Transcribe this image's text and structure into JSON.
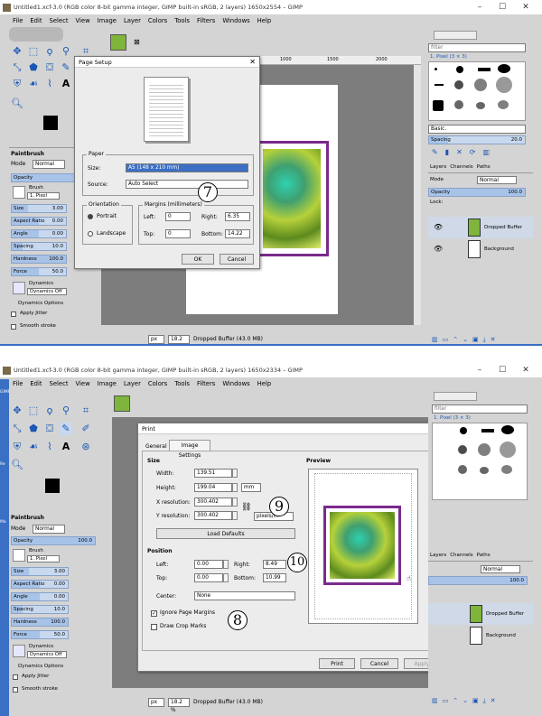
{
  "top": {
    "window_title": "Untitled1.xcf-3.0 (RGB color 8-bit gamma integer, GIMP built-in sRGB, 2 layers) 1650x2554 – GIMP",
    "menu": [
      "File",
      "Edit",
      "Select",
      "View",
      "Image",
      "Layer",
      "Colors",
      "Tools",
      "Filters",
      "Windows",
      "Help"
    ],
    "ruler_marks": [
      "1000",
      "1500",
      "2000"
    ],
    "tool_options": {
      "panel_title": "Paintbrush",
      "mode_label": "Mode",
      "mode_value": "Normal",
      "opacity_label": "Opacity",
      "brush_label": "Brush",
      "brush_value": "1. Pixel",
      "size": {
        "label": "Size",
        "value": "3.00"
      },
      "aspect": {
        "label": "Aspect Ratio",
        "value": "0.00"
      },
      "angle": {
        "label": "Angle",
        "value": "0.00"
      },
      "spacing": {
        "label": "Spacing",
        "value": "10.0"
      },
      "hardness": {
        "label": "Hardness",
        "value": "100.0"
      },
      "force": {
        "label": "Force",
        "value": "50.0"
      },
      "dynamics_label": "Dynamics",
      "dynamics_value": "Dynamics Off",
      "dynamics_options": "Dynamics Options",
      "apply_jitter": "Apply Jitter",
      "smooth_stroke": "Smooth stroke"
    },
    "page_setup": {
      "title": "Page Setup",
      "paper_group": "Paper",
      "size_label": "Size:",
      "size_value": "A5 (148 x 210 mm)",
      "source_label": "Source:",
      "source_value": "Auto Select",
      "orientation_group": "Orientation",
      "portrait": "Portrait",
      "landscape": "Landscape",
      "margins_group": "Margins (millimeters)",
      "left_label": "Left:",
      "left_value": "0",
      "right_label": "Right:",
      "right_value": "6.35",
      "top_label": "Top:",
      "top_value": "0",
      "bottom_label": "Bottom:",
      "bottom_value": "14.22",
      "ok": "OK",
      "cancel": "Cancel"
    },
    "callout": "7",
    "status_unit": "px",
    "status_zoom": "18.2 %",
    "status_text": "Dropped Buffer (43.0 MB)",
    "right_panel": {
      "filter_placeholder": "filter",
      "brush_name": "1. Pixel (3 × 3)",
      "preset": "Basic.",
      "spacing_label": "Spacing",
      "spacing_value": "20.0",
      "tabs": [
        "Layers",
        "Channels",
        "Paths"
      ],
      "mode_label": "Mode",
      "mode_value": "Normal",
      "opacity_label": "Opacity",
      "opacity_value": "100.0",
      "lock_label": "Lock:",
      "layers": [
        "Dropped Buffer",
        "Background"
      ]
    }
  },
  "bottom": {
    "window_title": "Untitled1.xcf-3.0 (RGB color 8-bit gamma integer, GIMP built-in sRGB, 2 layers) 1650x2334 – GIMP",
    "menu": [
      "File",
      "Edit",
      "Select",
      "View",
      "Image",
      "Layer",
      "Colors",
      "Tools",
      "Filters",
      "Windows",
      "Help"
    ],
    "side_labels": [
      "GIMP",
      "Re",
      "Ma"
    ],
    "tool_options": {
      "panel_title": "Paintbrush",
      "mode_label": "Mode",
      "mode_value": "Normal",
      "opacity_label": "Opacity",
      "opacity_value": "100.0",
      "brush_label": "Brush",
      "brush_value": "1. Pixel",
      "size": {
        "label": "Size",
        "value": "3.00"
      },
      "aspect": {
        "label": "Aspect Ratio",
        "value": "0.00"
      },
      "angle": {
        "label": "Angle",
        "value": "0.00"
      },
      "spacing": {
        "label": "Spacing",
        "value": "10.0"
      },
      "hardness": {
        "label": "Hardness",
        "value": "100.0"
      },
      "force": {
        "label": "Force",
        "value": "50.0"
      },
      "dynamics_label": "Dynamics",
      "dynamics_value": "Dynamics Off",
      "dynamics_options": "Dynamics Options",
      "apply_jitter": "Apply Jitter",
      "smooth_stroke": "Smooth stroke"
    },
    "print": {
      "title": "Print",
      "tab_general": "General",
      "tab_image": "Image Settings",
      "size_section": "Size",
      "width_label": "Width:",
      "width_value": "139.51",
      "height_label": "Height:",
      "height_value": "199.04",
      "unit": "mm",
      "xres_label": "X resolution:",
      "xres_value": "300.402",
      "yres_label": "Y resolution:",
      "yres_value": "300.402",
      "res_unit": "pixels/in",
      "load_defaults": "Load Defaults",
      "position_section": "Position",
      "left_label": "Left:",
      "left_value": "0.00",
      "right_label": "Right:",
      "right_value": "8.49",
      "top_label": "Top:",
      "top_value": "0.00",
      "bottom_label": "Bottom:",
      "bottom_value": "10.99",
      "center_label": "Center:",
      "center_value": "None",
      "ignore_margins": "Ignore Page Margins",
      "draw_crop": "Draw Crop Marks",
      "preview": "Preview",
      "btn_print": "Print",
      "btn_cancel": "Cancel",
      "btn_apply": "Apply"
    },
    "callouts": [
      "9",
      "10",
      "8"
    ],
    "status_unit": "px",
    "status_zoom": "18.2 %",
    "status_text": "Dropped Buffer (43.0 MB)",
    "right_panel": {
      "filter_placeholder": "filter",
      "brush_name": "1. Pixel (3 × 3)",
      "tabs": [
        "Layers",
        "Channels",
        "Paths"
      ],
      "mode_value": "Normal",
      "opacity_value": "100.0",
      "layers": [
        "Dropped Buffer",
        "Background"
      ]
    }
  },
  "colors": {
    "accent": "#1a57b5",
    "frame": "#7a2a8c",
    "selection": "#3c6fc4"
  }
}
